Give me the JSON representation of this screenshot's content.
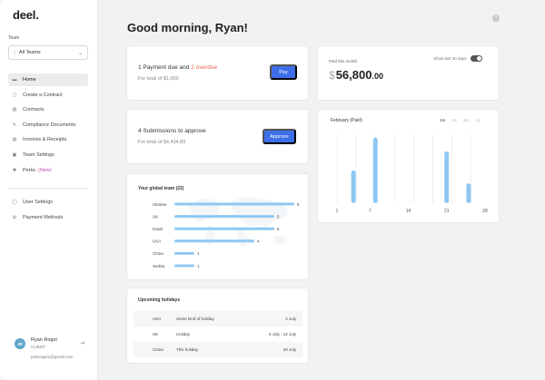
{
  "sidebar": {
    "logo": "deel",
    "team_label": "Team",
    "team_select": "All Teams",
    "nav": [
      {
        "label": "Home",
        "icon": "home-icon",
        "glyph": "▬"
      },
      {
        "label": "Create a Contract",
        "icon": "add-contract-icon",
        "glyph": "▢"
      },
      {
        "label": "Contracts",
        "icon": "contracts-icon",
        "glyph": "▤"
      },
      {
        "label": "Compliance Documents",
        "icon": "compliance-icon",
        "glyph": "✎"
      },
      {
        "label": "Invoices & Receipts",
        "icon": "invoice-icon",
        "glyph": "▤"
      },
      {
        "label": "Team Settings",
        "icon": "team-settings-icon",
        "glyph": "▣"
      },
      {
        "label": "Perks",
        "icon": "perks-icon",
        "glyph": "✱",
        "badge": "(New)"
      }
    ],
    "nav2": [
      {
        "label": "User Settings",
        "icon": "user-icon",
        "glyph": "◯"
      },
      {
        "label": "Payment Methods",
        "icon": "gear-icon",
        "glyph": "⚙"
      }
    ],
    "user": {
      "initials": "JR",
      "name": "Ryan Roger",
      "role": "CLIENT",
      "email": "johnrogers@gmail.com"
    }
  },
  "header": {
    "greeting": "Good morning, Ryan!"
  },
  "payment": {
    "title_prefix": "1 Payment due and ",
    "overdue": "2 overdue",
    "subtitle": "For total of $1,000",
    "button": "Pay"
  },
  "submissions": {
    "title": "4 Submissions to approve",
    "subtitle": "For total of $4,434.89",
    "button": "Approve"
  },
  "paid": {
    "label": "Paid this month",
    "currency": "$",
    "amount": "56,800",
    "cents": ".00",
    "toggle_label": "Show last 30 days"
  },
  "chart": {
    "title": "February (Paid)",
    "tabs": [
      "1m",
      "3m",
      "6m",
      "1y"
    ]
  },
  "chart_data": [
    {
      "type": "bar",
      "title": "February (Paid)",
      "x": [
        4,
        8,
        13,
        16,
        21,
        25
      ],
      "values": [
        38,
        76,
        0,
        0,
        60,
        23
      ],
      "xticks": [
        "1",
        "7",
        "14",
        "21",
        "28"
      ],
      "xtick_values": [
        1,
        7,
        14,
        21,
        28
      ],
      "xlim": [
        0.5,
        29
      ],
      "ylim": [
        0,
        80
      ],
      "grid": "vertical",
      "color": "#8ec8f2"
    },
    {
      "type": "bar",
      "orientation": "horizontal",
      "title": "Your global team (22)",
      "categories": [
        "Ukraine",
        "UK",
        "Israel",
        "USA",
        "China",
        "Serbia"
      ],
      "values": [
        6,
        5,
        5,
        4,
        1,
        1
      ],
      "xlim": [
        0,
        6
      ],
      "color": "#8ec8f2"
    }
  ],
  "team": {
    "title": "Your global team (22)"
  },
  "holidays": {
    "title": "Upcoming holidays",
    "rows": [
      {
        "country": "USA",
        "name": "Some kind of holiday",
        "date": "4 July"
      },
      {
        "country": "UK",
        "name": "Holiday",
        "date": "6 July - 12 July"
      },
      {
        "country": "China",
        "name": "This holiday",
        "date": "28 July"
      }
    ]
  },
  "colors": {
    "accent": "#3d6fe8",
    "overdue": "#e8694b",
    "bar": "#8ec8f2",
    "perks_badge": "#c44fb0"
  }
}
